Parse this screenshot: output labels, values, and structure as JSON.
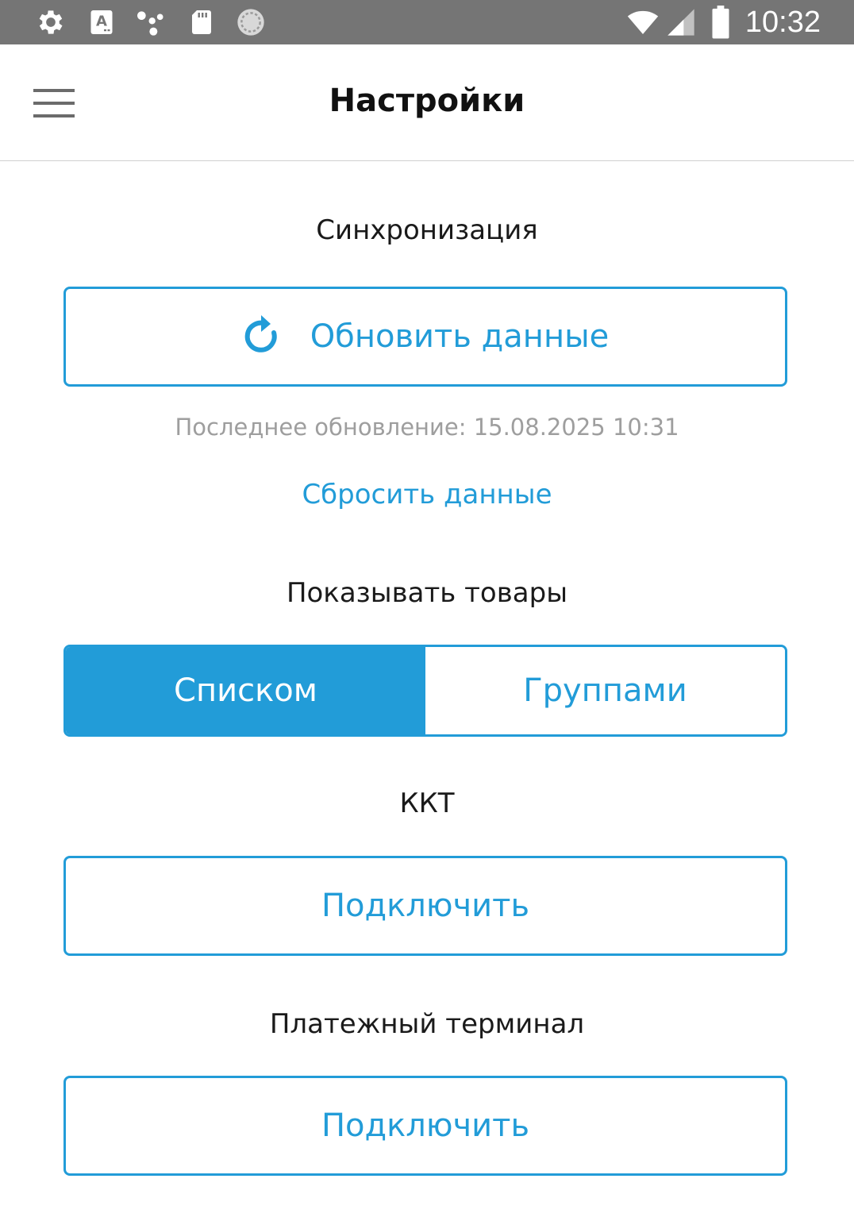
{
  "status_bar": {
    "time": "10:32",
    "left_icons": [
      "gear-icon",
      "keyboard-a-icon",
      "assistant-dots-icon",
      "sd-card-icon",
      "sync-circle-icon"
    ],
    "right_icons": [
      "wifi-icon",
      "signal-icon",
      "battery-icon"
    ]
  },
  "header": {
    "title": "Настройки",
    "menu_icon": "hamburger-menu-icon"
  },
  "sync": {
    "label": "Синхронизация",
    "refresh_button": "Обновить данные",
    "refresh_icon": "refresh-icon",
    "last_update": "Последнее обновление: 15.08.2025 10:31",
    "reset_link": "Сбросить данные"
  },
  "display": {
    "label": "Показывать товары",
    "options": [
      "Списком",
      "Группами"
    ],
    "selected": "Списком"
  },
  "kkt": {
    "label": "ККТ",
    "connect_button": "Подключить"
  },
  "terminal": {
    "label": "Платежный терминал",
    "connect_button": "Подключить"
  },
  "colors": {
    "accent": "#229cd8",
    "status_bar": "#757575",
    "hint_text": "#9e9e9e"
  }
}
